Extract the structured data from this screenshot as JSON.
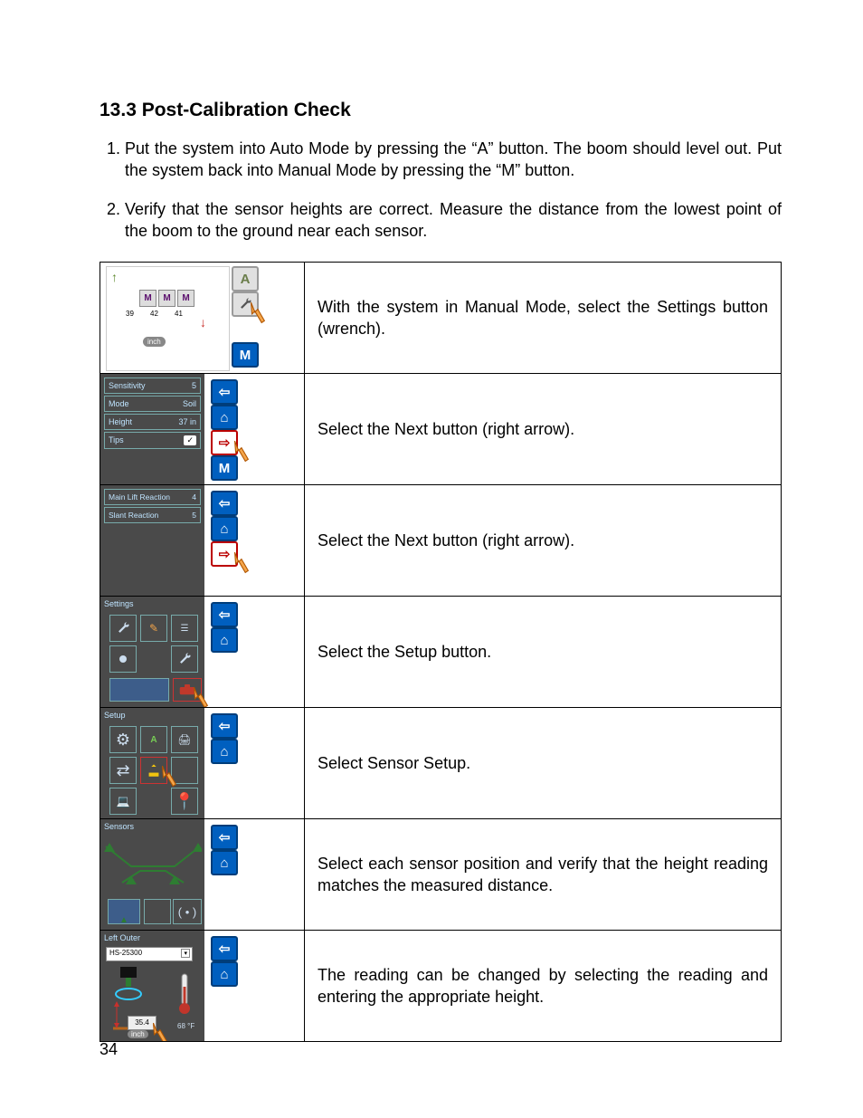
{
  "pageNumber": "34",
  "heading": "13.3  Post-Calibration Check",
  "steps": [
    "Put the system into Auto Mode by pressing the “A” button.  The boom should level out.  Put the system back into Manual Mode by pressing the “M” button.",
    "Verify that the sensor heights are correct.  Measure the distance from the lowest point of the boom to the ground near each sensor."
  ],
  "rows": [
    {
      "desc": "With the system in Manual Mode, select the Settings button (wrench)."
    },
    {
      "desc": "Select the Next button (right arrow)."
    },
    {
      "desc": "Select the Next button (right arrow)."
    },
    {
      "desc": "Select the Setup button."
    },
    {
      "desc": "Select Sensor Setup."
    },
    {
      "desc": "Select each sensor position and verify that the height reading matches the measured distance."
    },
    {
      "desc": "The reading can be changed by selecting the reading and entering the appropriate height."
    }
  ],
  "shot1": {
    "values": [
      "39",
      "42",
      "41"
    ],
    "unit": "inch",
    "aLabel": "A",
    "mLabel": "M",
    "mTag": "M"
  },
  "shot2": {
    "rows": [
      {
        "label": "Sensitivity",
        "val": "5"
      },
      {
        "label": "Mode",
        "val": "Soil"
      },
      {
        "label": "Height",
        "val": "37 in"
      },
      {
        "label": "Tips",
        "val": "✓"
      }
    ]
  },
  "shot3": {
    "rows": [
      {
        "label": "Main Lift Reaction",
        "val": "4"
      },
      {
        "label": "Slant Reaction",
        "val": "5"
      }
    ]
  },
  "shot4": {
    "title": "Settings"
  },
  "shot5": {
    "title": "Setup"
  },
  "shot6": {
    "title": "Sensors"
  },
  "shot7": {
    "title": "Left Outer",
    "sensorId": "HS-25300",
    "reading": "35.4",
    "unit": "inch",
    "temp": "68 °F"
  }
}
